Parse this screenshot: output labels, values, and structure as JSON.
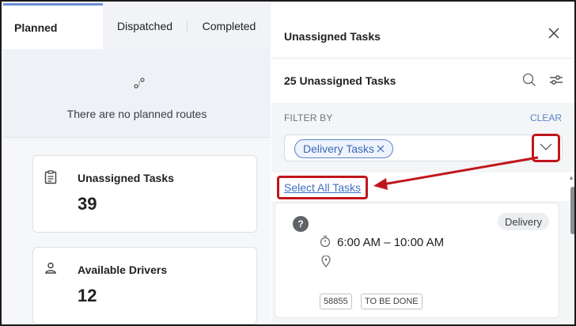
{
  "tabs": {
    "planned": "Planned",
    "dispatched": "Dispatched",
    "completed": "Completed"
  },
  "planned_panel": {
    "empty_message": "There are no planned routes",
    "route_icon": "route-icon"
  },
  "cards": {
    "unassigned": {
      "icon": "clipboard-icon",
      "title": "Unassigned Tasks",
      "count": "39"
    },
    "drivers": {
      "icon": "person-icon",
      "title": "Available Drivers",
      "count": "12"
    }
  },
  "right_panel": {
    "title": "Unassigned Tasks",
    "count_label": "25 Unassigned Tasks",
    "filter_label": "FILTER BY",
    "clear_label": "CLEAR",
    "chip_label": "Delivery Tasks",
    "select_all_label": "Select All Tasks"
  },
  "task": {
    "badge_symbol": "?",
    "type": "Delivery",
    "time_range": "6:00 AM – 10:00 AM",
    "id_tag": "58855",
    "status_tag": "TO BE DONE"
  },
  "colors": {
    "accent": "#5b84cc",
    "annotation": "#c0161c",
    "tab_indicator": "#6a8fd6"
  }
}
